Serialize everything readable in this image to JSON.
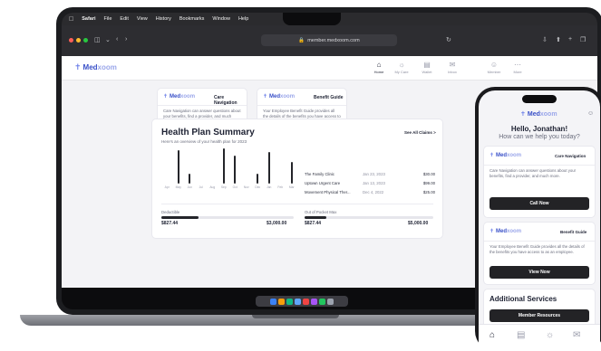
{
  "macos_menu": {
    "app": "Safari",
    "items": [
      "File",
      "Edit",
      "View",
      "History",
      "Bookmarks",
      "Window",
      "Help"
    ]
  },
  "browser": {
    "url": "member.medxoom.com"
  },
  "brand": {
    "name_main": "Med",
    "name_accent": "xoom",
    "color": "#3950c8"
  },
  "nav": {
    "items": [
      {
        "label": "Home",
        "icon": "home-icon"
      },
      {
        "label": "My Care",
        "icon": "care-icon"
      },
      {
        "label": "Wallet",
        "icon": "wallet-icon"
      },
      {
        "label": "Inbox",
        "icon": "inbox-icon"
      },
      {
        "label": "Member",
        "icon": "user-icon"
      },
      {
        "label": "More",
        "icon": "more-icon"
      }
    ]
  },
  "cards": [
    {
      "tag": "Care Navigation",
      "text": "Care Navigation can answer questions about your benefits, find a provider, and much more.",
      "button": "Call Now"
    },
    {
      "tag": "Benefit Guide",
      "text": "Your Employee Benefit Guide provides all the details of the benefits you have access to as an employee.",
      "button": "View Now"
    }
  ],
  "summary": {
    "title": "Health Plan Summary",
    "subtitle": "Here's an overview of your health plan for 2023",
    "see_all": "See All Claims >",
    "chart_data": {
      "type": "bar",
      "categories": [
        "Apr",
        "May",
        "Jun",
        "Jul",
        "Aug",
        "Sep",
        "Oct",
        "Nov",
        "Dec",
        "Jan",
        "Feb",
        "Mar"
      ],
      "values": [
        0,
        95,
        28,
        0,
        0,
        100,
        80,
        0,
        28,
        90,
        0,
        62
      ]
    },
    "claims": [
      {
        "name": "The Family Clinic",
        "date": "Jan 23, 2023",
        "amount": "$30.00"
      },
      {
        "name": "Uptown Urgent Care",
        "date": "Jan 13, 2023",
        "amount": "$99.00"
      },
      {
        "name": "Movement Physical Ther...",
        "date": "Dec 4, 2022",
        "amount": "$25.00"
      }
    ],
    "deductible": {
      "label": "Deductible",
      "spent": "$827.44",
      "total": "$3,000.00",
      "fraction": 0.28
    },
    "oop": {
      "label": "Out of Pocket Max",
      "spent": "$827.44",
      "total": "$5,000.00",
      "fraction": 0.17
    }
  },
  "phone": {
    "greeting": "Hello, Jonathan!",
    "question": "How can we help you today?",
    "section_title": "Additional Services",
    "member_resources": "Member Resources"
  },
  "colors": {
    "accent": "#3950c8",
    "dark_button": "#232326",
    "page_bg": "#f3f3f6"
  }
}
